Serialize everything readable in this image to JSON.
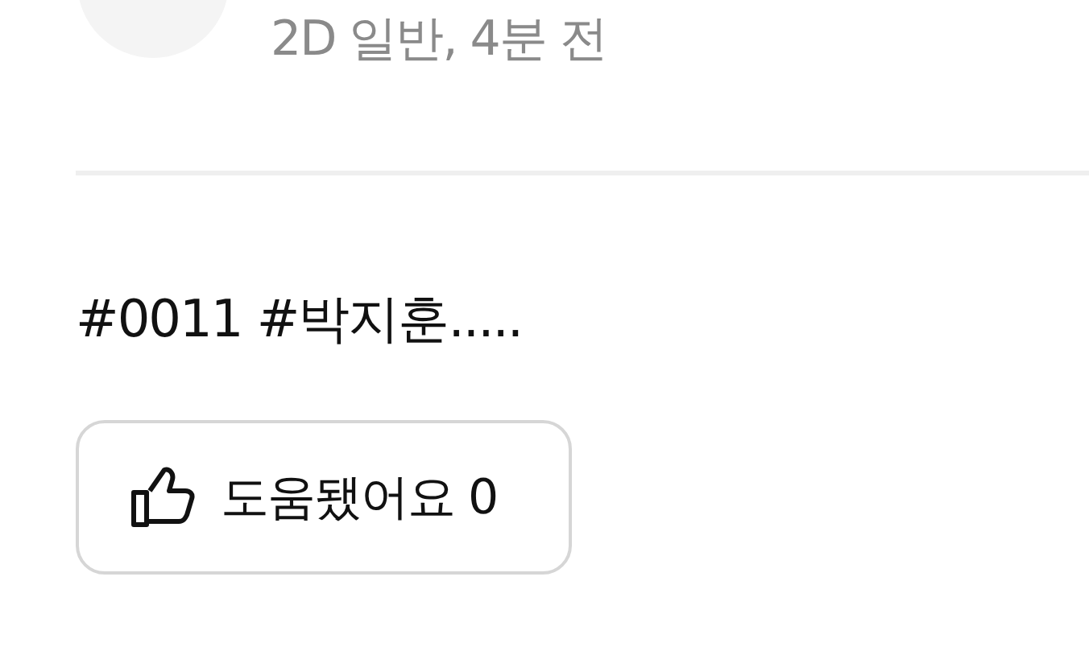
{
  "post": {
    "meta": "2D 일반, 4분 전",
    "body": "#0011 #박지훈.....",
    "helpful_button": {
      "label": "도움됐어요 0"
    }
  }
}
